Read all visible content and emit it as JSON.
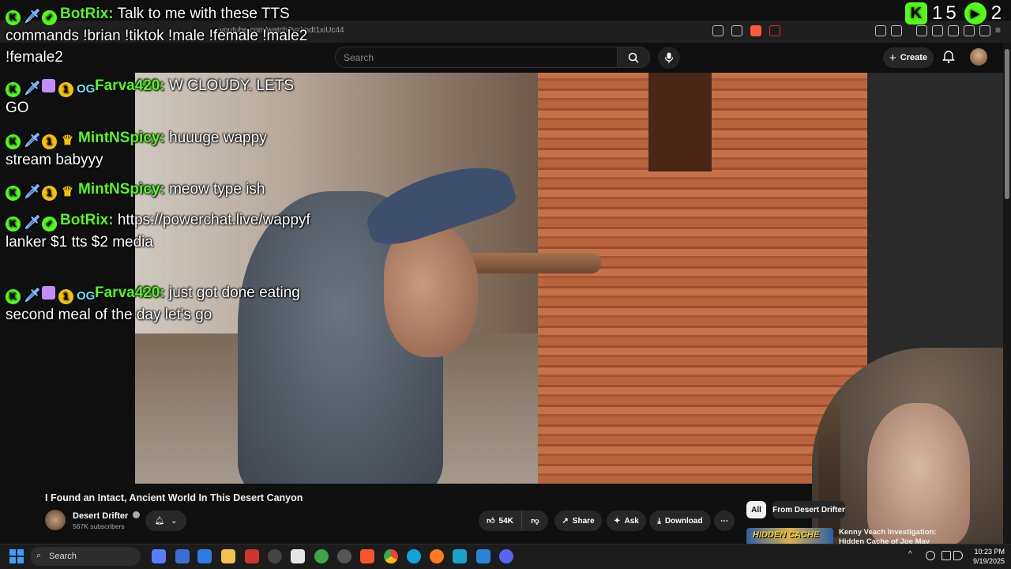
{
  "browser": {
    "url": "youtube.com/watch?v=lmdt1xiUc44"
  },
  "youtube": {
    "search_placeholder": "Search",
    "create_label": "Create"
  },
  "video": {
    "title": "I Found an Intact, Ancient World In This Desert Canyon",
    "channel": "Desert Drifter",
    "subscribers": "567K subscribers",
    "likes": "54K",
    "share_label": "Share",
    "ask_label": "Ask",
    "download_label": "Download"
  },
  "sidebar": {
    "chip_all": "All",
    "chip_from": "From Desert Drifter",
    "rec_thumb_text": "HIDDEN CACHE",
    "rec_title": "Kenny Veach Investigation: Hidden Cache of Joe May"
  },
  "counter": {
    "viewers": "15",
    "second": "2"
  },
  "chat": [
    {
      "user": "BotRix:",
      "text": "Talk to me with these TTS commands !brian !tiktok !male !female !male2 !female2"
    },
    {
      "user": "Farva420:",
      "text": "W CLOUDY. LETS GO"
    },
    {
      "user": "MintNSpicy:",
      "text": "huuuge wappy stream babyyy"
    },
    {
      "user": "MintNSpicy:",
      "text": "meow type ish"
    },
    {
      "user": "BotRix:",
      "text": "https://powerchat.live/wappyflanker $1 tts $2 media"
    },
    {
      "user": "Farva420:",
      "text": "just got done eating second meal of the day let's go"
    }
  ],
  "taskbar": {
    "search_label": "Search",
    "time": "10:23 PM",
    "date": "9/19/2025"
  },
  "colors": {
    "kick_green": "#53fc18",
    "yt_bg": "#0f0f0f"
  }
}
